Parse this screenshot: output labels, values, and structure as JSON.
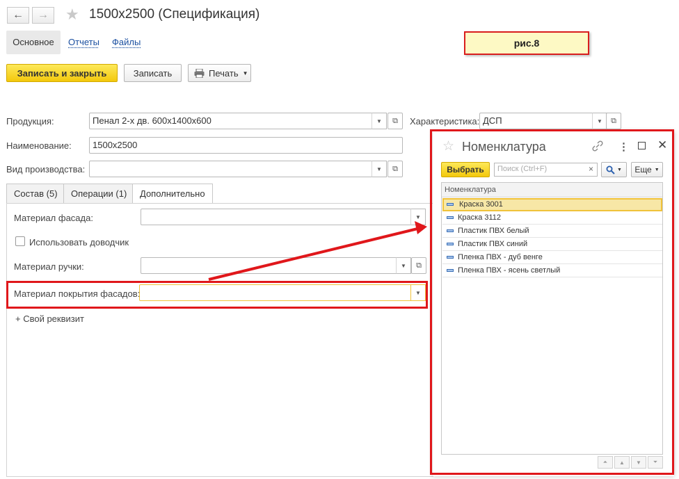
{
  "window": {
    "title": "1500x2500 (Спецификация)",
    "nav_back": "←",
    "nav_forward": "→"
  },
  "top_tabs": {
    "main": "Основное",
    "reports": "Отчеты",
    "files": "Файлы"
  },
  "toolbar": {
    "save_close": "Записать и закрыть",
    "save": "Записать",
    "print": "Печать"
  },
  "annotation": "рис.8",
  "form": {
    "product_label": "Продукция:",
    "product_value": "Пенал 2-х дв. 600х1400х600",
    "characteristic_label": "Характеристика:",
    "characteristic_value": "ДСП",
    "name_label": "Наименование:",
    "name_value": "1500x2500",
    "production_label": "Вид производства:",
    "production_value": ""
  },
  "inner_tabs": [
    "Состав (5)",
    "Операции (1)",
    "Дополнительно"
  ],
  "additional": {
    "facade_material_label": "Материал фасада:",
    "closer_checkbox_label": "Использовать доводчик",
    "closer_checked": false,
    "handle_material_label": "Материал ручки:",
    "coating_material_label": "Материал покрытия фасадов:",
    "add_attribute": "+ Свой реквизит"
  },
  "dialog": {
    "title": "Номенклатура",
    "select_button": "Выбрать",
    "search_placeholder": "Поиск (Ctrl+F)",
    "more_button": "Еще",
    "column_header": "Номенклатура",
    "items": [
      "Краска 3001",
      "Краска 3112",
      "Пластик ПВХ белый",
      "Пластик ПВХ синий",
      "Пленка ПВХ - дуб венге",
      "Пленка ПВХ - ясень светлый"
    ],
    "selected_index": 0
  },
  "colors": {
    "accent_yellow": "#f5d31c",
    "highlight_red": "#e0171b",
    "link_blue": "#1a4fa0",
    "selection": "#f7e7a6"
  }
}
